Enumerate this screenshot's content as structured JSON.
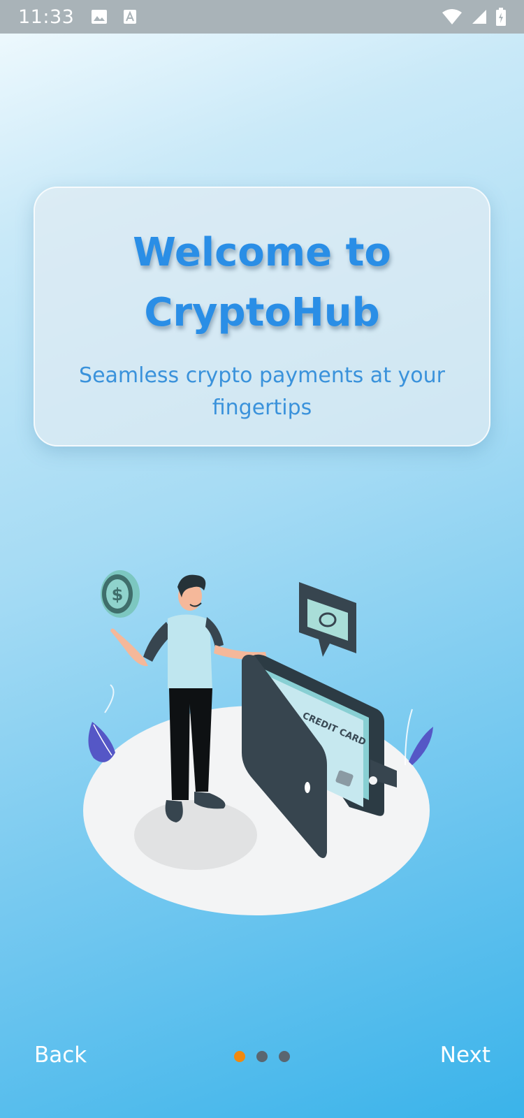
{
  "status_bar": {
    "time": "11:33",
    "icons_left": [
      "image-icon",
      "font-icon"
    ],
    "icons_right": [
      "wifi-icon",
      "signal-icon",
      "battery-icon"
    ]
  },
  "welcome_card": {
    "title": "Welcome to CryptoHub",
    "subtitle": "Seamless crypto payments at your fingertips"
  },
  "illustration": {
    "card_label": "CREDIT CARD",
    "icons": [
      "coin-icon",
      "money-speech-bubble-icon",
      "wallet-icon",
      "person-icon",
      "leaf-icon"
    ]
  },
  "navigation": {
    "back_label": "Back",
    "next_label": "Next",
    "total_pages": 3,
    "current_page": 1
  },
  "colors": {
    "accent": "#2a8ee6",
    "active_dot": "#f0890f",
    "inactive_dot": "#5a6670"
  }
}
